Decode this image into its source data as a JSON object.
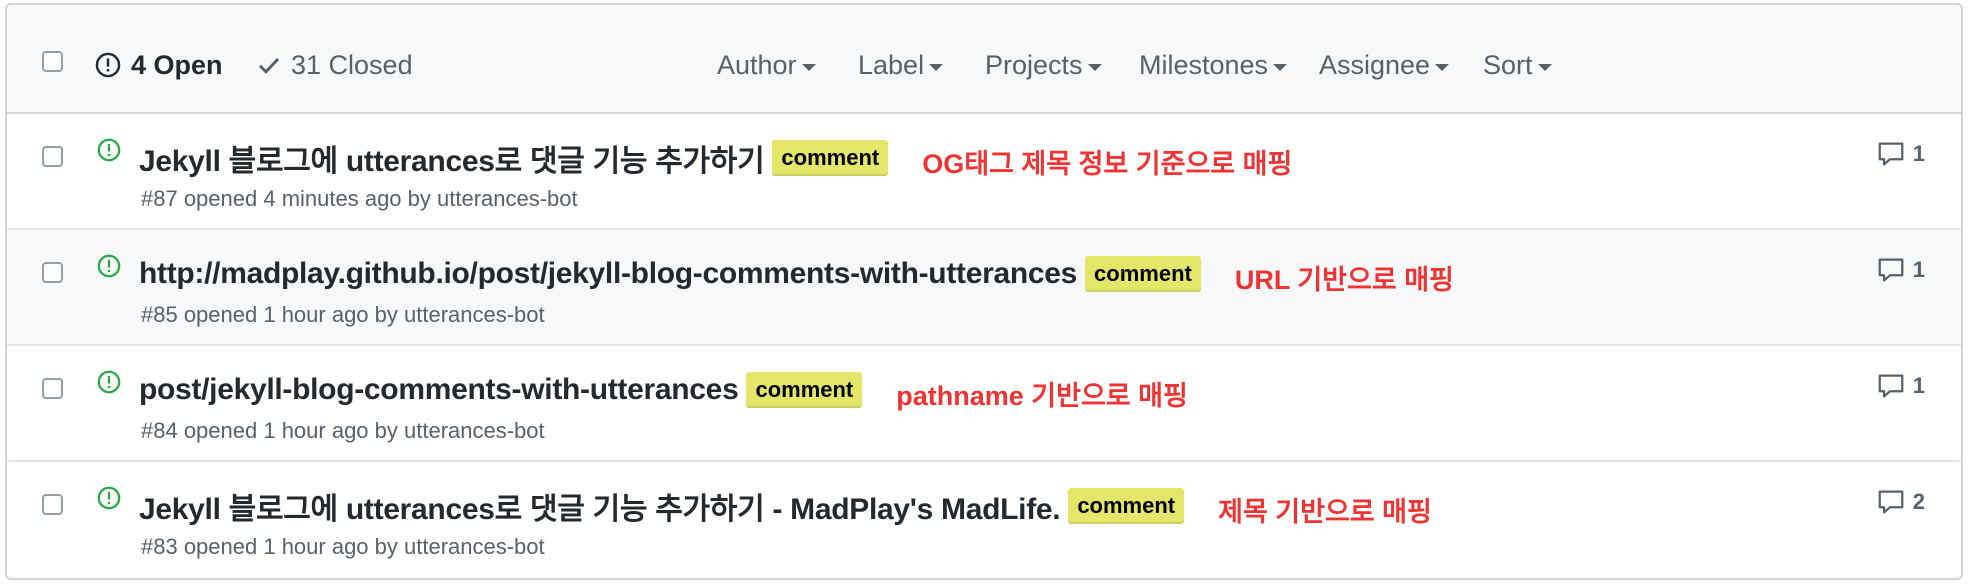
{
  "header": {
    "open_label": "4 Open",
    "closed_label": "31 Closed",
    "filters": [
      "Author",
      "Label",
      "Projects",
      "Milestones",
      "Assignee",
      "Sort"
    ]
  },
  "issues": [
    {
      "title": "Jekyll 블로그에 utterances로 댓글 기능 추가하기",
      "label": "comment",
      "note": "OG태그 제목 정보 기준으로 매핑",
      "meta": "#87 opened 4 minutes ago by utterances-bot",
      "comment_count": "1"
    },
    {
      "title": "http://madplay.github.io/post/jekyll-blog-comments-with-utterances",
      "label": "comment",
      "note": "URL 기반으로 매핑",
      "meta": "#85 opened 1 hour ago by utterances-bot",
      "comment_count": "1"
    },
    {
      "title": "post/jekyll-blog-comments-with-utterances",
      "label": "comment",
      "note": "pathname 기반으로 매핑",
      "meta": "#84 opened 1 hour ago by utterances-bot",
      "comment_count": "1"
    },
    {
      "title": "Jekyll 블로그에 utterances로 댓글 기능 추가하기 - MadPlay's MadLife.",
      "label": "comment",
      "note": "제목 기반으로 매핑",
      "meta": "#83 opened 1 hour ago by utterances-bot",
      "comment_count": "2"
    }
  ],
  "colors": {
    "open_icon": "#28a745",
    "label_bg": "#e4e669",
    "annotation": "#ee3333"
  }
}
